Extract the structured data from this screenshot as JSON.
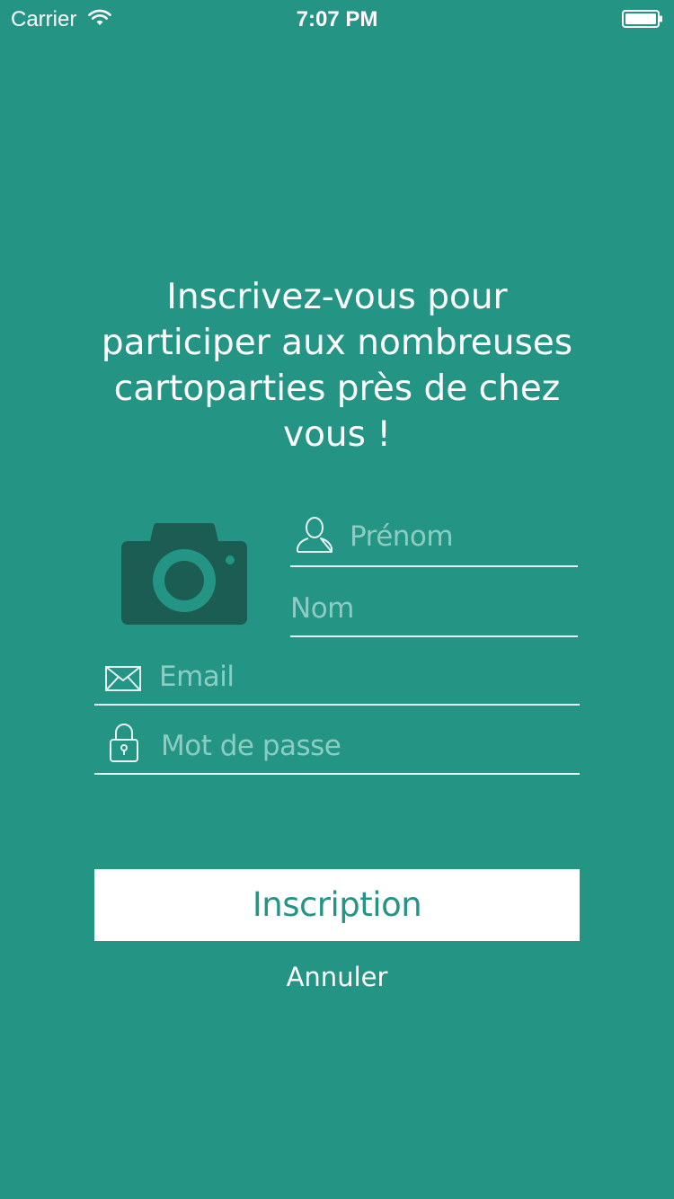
{
  "status_bar": {
    "carrier": "Carrier",
    "time": "7:07 PM",
    "wifi_icon": "wifi-icon",
    "battery_icon": "battery-icon"
  },
  "headline": "Inscrivez-vous pour participer aux nombreuses cartoparties près de chez vous !",
  "avatar_icon": "camera-icon",
  "form": {
    "first_name": {
      "placeholder": "Prénom",
      "value": "",
      "icon": "user-icon"
    },
    "last_name": {
      "placeholder": "Nom",
      "value": ""
    },
    "email": {
      "placeholder": "Email",
      "value": "",
      "icon": "envelope-icon"
    },
    "password": {
      "placeholder": "Mot de passe",
      "value": "",
      "icon": "lock-icon"
    }
  },
  "actions": {
    "submit_label": "Inscription",
    "cancel_label": "Annuler"
  },
  "colors": {
    "background": "#249485",
    "camera": "#1b5c53",
    "placeholder": "#8ccdc3",
    "button_bg": "#ffffff",
    "button_text": "#249485"
  }
}
